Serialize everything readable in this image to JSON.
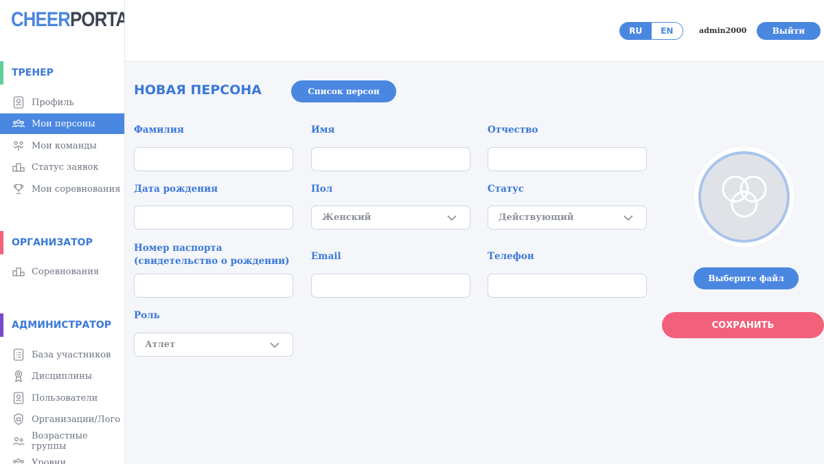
{
  "app": {
    "logo_part1": "CHEER",
    "logo_part2": "PORTAL"
  },
  "header": {
    "lang_ru": "RU",
    "lang_en": "EN",
    "active_lang": "RU",
    "username": "admin2000",
    "logout_label": "Выйти"
  },
  "sidebar": {
    "sections": [
      {
        "title": "ТРЕНЕР",
        "color": "#5ecf96"
      },
      {
        "title": "ОРГАНИЗАТОР",
        "color": "#f2607a"
      },
      {
        "title": "АДМИНИСТРАТОР",
        "color": "#7b48c9"
      }
    ],
    "trainer_items": [
      {
        "label": "Профиль",
        "icon": "badge-icon"
      },
      {
        "label": "Мои персоны",
        "icon": "people-icon",
        "active": true
      },
      {
        "label": "Мои команды",
        "icon": "team-icon"
      },
      {
        "label": "Статус заявок",
        "icon": "podium-icon"
      },
      {
        "label": "Мои соревнования",
        "icon": "trophy-icon"
      }
    ],
    "organizer_items": [
      {
        "label": "Соревнования",
        "icon": "podium-icon"
      }
    ],
    "admin_items": [
      {
        "label": "База участников",
        "icon": "list-icon"
      },
      {
        "label": "Дисциплины",
        "icon": "medal-icon"
      },
      {
        "label": "Пользователи",
        "icon": "badge-icon"
      },
      {
        "label": "Организации/Лого",
        "icon": "shield-icon"
      },
      {
        "label": "Возрастные группы",
        "icon": "group-icon"
      },
      {
        "label": "Уровни",
        "icon": "people-icon"
      }
    ]
  },
  "main": {
    "title": "НОВАЯ ПЕРСОНА",
    "list_button": "Список персон",
    "fields": {
      "last_name": {
        "label": "Фамилия",
        "value": ""
      },
      "first_name": {
        "label": "Имя",
        "value": ""
      },
      "middle_name": {
        "label": "Отчество",
        "value": ""
      },
      "birth_date": {
        "label": "Дата рождения",
        "value": ""
      },
      "gender": {
        "label": "Пол",
        "value": "Женский"
      },
      "status": {
        "label": "Статус",
        "value": "Действующий"
      },
      "passport": {
        "label_line1": "Номер паспорта",
        "label_line2": "(свидетельство о рождении)",
        "value": ""
      },
      "email": {
        "label": "Email",
        "value": ""
      },
      "phone": {
        "label": "Телефон",
        "value": ""
      },
      "role": {
        "label": "Роль",
        "value": "Атлет"
      }
    },
    "choose_file_button": "Выберите файл",
    "save_button": "СОХРАНИТЬ"
  },
  "colors": {
    "primary": "#4a87e0",
    "save": "#f2607a",
    "label": "#3a78d8"
  }
}
